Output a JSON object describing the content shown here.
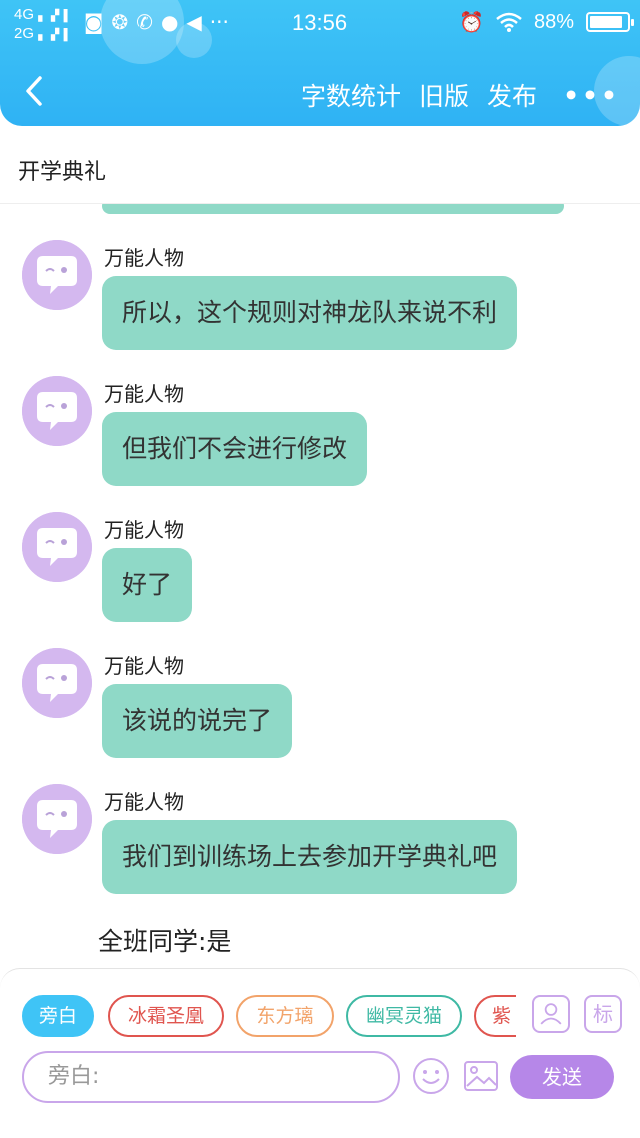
{
  "status_bar": {
    "network_top": "4G",
    "network_bottom": "2G",
    "time": "13:56",
    "battery": "88%",
    "icons": [
      "sim-icon",
      "wechat-icon",
      "missed-call-icon",
      "message-icon",
      "volume-icon",
      "more-dots-icon",
      "alarm-icon",
      "wifi-icon",
      "battery-icon"
    ]
  },
  "nav": {
    "back_icon": "chevron-left-icon",
    "word_count": "字数统计",
    "old_version": "旧版",
    "publish": "发布",
    "more": "•••"
  },
  "title": "开学典礼",
  "messages": [
    {
      "name": "万能人物",
      "text": "所以，这个规则对神龙队来说不利"
    },
    {
      "name": "万能人物",
      "text": "但我们不会进行修改"
    },
    {
      "name": "万能人物",
      "text": "好了"
    },
    {
      "name": "万能人物",
      "text": "该说的说完了"
    },
    {
      "name": "万能人物",
      "text": "我们到训练场上去参加开学典礼吧"
    }
  ],
  "narration": "全班同学:是",
  "characters": [
    {
      "label": "旁白",
      "color": "#3fc4f6",
      "selected": true
    },
    {
      "label": "冰霜圣凰",
      "color": "#e0554f",
      "selected": false
    },
    {
      "label": "东方璃",
      "color": "#f2a36a",
      "selected": false
    },
    {
      "label": "幽冥灵猫",
      "color": "#3fb9a4",
      "selected": false
    },
    {
      "label": "紫",
      "color": "#e0554f",
      "selected": false
    }
  ],
  "tools": {
    "add_character_icon": "person-icon",
    "mark_label": "标",
    "emoji_icon": "smiley-icon",
    "image_icon": "image-icon"
  },
  "input": {
    "placeholder": "旁白:"
  },
  "send_label": "发送",
  "colors": {
    "header": "#3fc4f6",
    "bubble": "#8fd9c7",
    "accent": "#b687e8",
    "avatar": "#d4b8ef"
  }
}
